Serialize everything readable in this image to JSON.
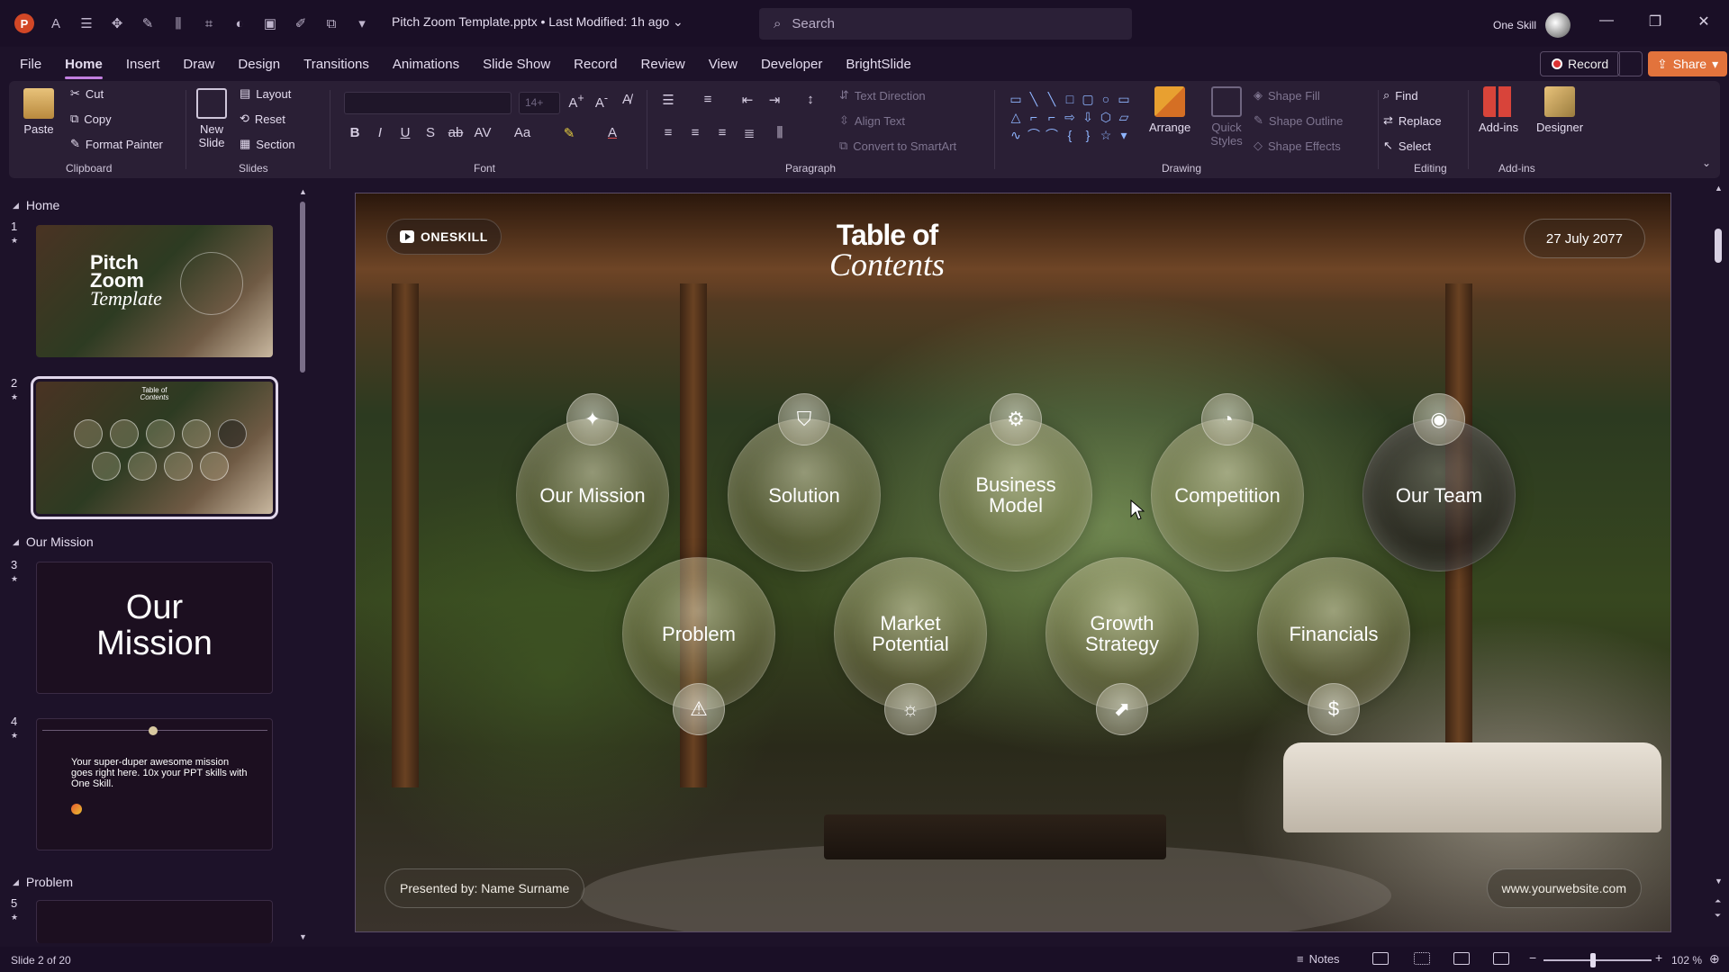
{
  "titlebar": {
    "doc_title": "Pitch Zoom Template.pptx • Last Modified: 1h ago ⌄",
    "search_placeholder": "Search",
    "user_name": "One Skill",
    "minimize": "—",
    "restore": "❐",
    "close": "✕"
  },
  "menu": {
    "tabs": [
      "File",
      "Home",
      "Insert",
      "Draw",
      "Design",
      "Transitions",
      "Animations",
      "Slide Show",
      "Record",
      "Review",
      "View",
      "Developer",
      "BrightSlide"
    ],
    "active": "Home",
    "record": "Record",
    "share": "Share"
  },
  "ribbon": {
    "clipboard": {
      "paste": "Paste",
      "cut": "Cut",
      "copy": "Copy",
      "format_painter": "Format Painter",
      "label": "Clipboard"
    },
    "slides": {
      "new_slide": "New Slide",
      "layout": "Layout",
      "reset": "Reset",
      "section": "Section",
      "label": "Slides"
    },
    "font": {
      "size_placeholder": "14+",
      "label": "Font"
    },
    "paragraph": {
      "text_direction": "Text Direction",
      "align_text": "Align Text",
      "convert_smartart": "Convert to SmartArt",
      "label": "Paragraph"
    },
    "drawing": {
      "arrange": "Arrange",
      "quick_styles": "Quick Styles",
      "shape_fill": "Shape Fill",
      "shape_outline": "Shape Outline",
      "shape_effects": "Shape Effects",
      "label": "Drawing"
    },
    "editing": {
      "find": "Find",
      "replace": "Replace",
      "select": "Select",
      "label": "Editing"
    },
    "addins": {
      "addins": "Add-ins",
      "designer": "Designer",
      "label": "Add-ins"
    }
  },
  "thumbnails": {
    "sections": [
      "Home",
      "Our Mission",
      "Problem"
    ],
    "slides": [
      {
        "num": "1",
        "title_l1": "Pitch",
        "title_l2": "Zoom",
        "title_l3": "Template"
      },
      {
        "num": "2",
        "title_l1": "Table of",
        "title_l2": "Contents"
      },
      {
        "num": "3",
        "title_l1": "Our",
        "title_l2": "Mission"
      },
      {
        "num": "4",
        "text": "Your super-duper awesome mission goes right here. 10x your PPT skills with One Skill."
      },
      {
        "num": "5"
      }
    ]
  },
  "slide": {
    "logo": "ONESKILL",
    "title_l1": "Table of",
    "title_l2": "Contents",
    "date": "27 July 2077",
    "presented_by": "Presented by: Name Surname",
    "website": "www.yourwebsite.com",
    "bubbles": [
      {
        "label": "Our Mission",
        "icon": "sparkle-icon"
      },
      {
        "label": "Solution",
        "icon": "shield-icon"
      },
      {
        "label": "Business Model",
        "icon": "gear-icon"
      },
      {
        "label": "Competition",
        "icon": "gauge-icon"
      },
      {
        "label": "Our Team",
        "icon": "team-icon"
      },
      {
        "label": "Problem",
        "icon": "warning-icon"
      },
      {
        "label": "Market Potential",
        "icon": "lightbulb-icon"
      },
      {
        "label": "Growth Strategy",
        "icon": "chart-icon"
      },
      {
        "label": "Financials",
        "icon": "dollar-icon"
      }
    ]
  },
  "status": {
    "slide_info": "Slide 2 of 20",
    "notes": "Notes",
    "zoom": "102 %"
  }
}
